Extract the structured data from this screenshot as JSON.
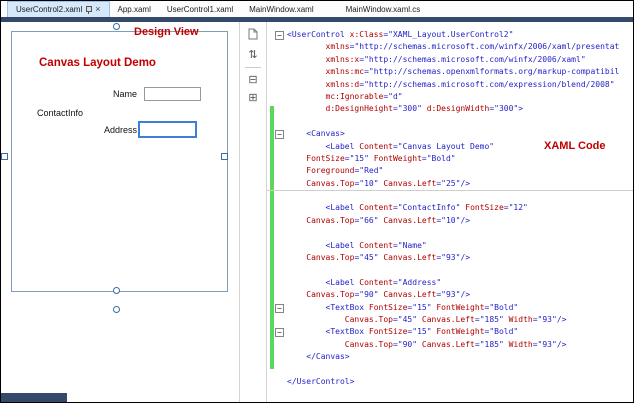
{
  "tabs": [
    {
      "label": "UserControl2.xaml",
      "active": true
    },
    {
      "label": "App.xaml",
      "active": false
    },
    {
      "label": "UserControl1.xaml",
      "active": false
    },
    {
      "label": "MainWindow.xaml",
      "active": false
    },
    {
      "label": "MainWindow.xaml.cs",
      "active": false
    }
  ],
  "icons": {
    "pin": "css-pin-shape",
    "close_glyph": "×",
    "document": "svg-page-shape",
    "swap_glyph": "⇅",
    "hsplit_glyph": "⊟",
    "vsplit_glyph": "⊞",
    "fold_glyph": "−"
  },
  "design": {
    "annotation": "Design View",
    "canvas_title": "Canvas Layout Demo",
    "name_label": "Name",
    "contactinfo_label": "ContactInfo",
    "address_label": "Address",
    "name_value": "",
    "address_value": ""
  },
  "annotations": {
    "xaml_code": "XAML Code"
  },
  "colors": {
    "accent_navy": "#35496b",
    "annotation_red": "#c00000",
    "code_tag_blue": "#1f1fc8",
    "code_attr_red": "#b00000",
    "code_value_blue": "#1f1fc8",
    "selection_blue": "#3d7fd6",
    "change_bar_green": "#5cd65c",
    "active_tab_bg": "#d6e9fb"
  },
  "code": {
    "lines": [
      {
        "fold": true,
        "seg": [
          [
            "t",
            "<UserControl "
          ],
          [
            "a",
            "x:Class"
          ],
          [
            "t",
            "="
          ],
          [
            "v",
            "\"XAML_Layout.UserControl2\""
          ]
        ]
      },
      {
        "seg": [
          [
            "t",
            "        "
          ],
          [
            "a",
            "xmlns"
          ],
          [
            "t",
            "="
          ],
          [
            "v",
            "\"http://schemas.microsoft.com/winfx/2006/xaml/presentat"
          ]
        ]
      },
      {
        "seg": [
          [
            "t",
            "        "
          ],
          [
            "a",
            "xmlns:x"
          ],
          [
            "t",
            "="
          ],
          [
            "v",
            "\"http://schemas.microsoft.com/winfx/2006/xaml\""
          ]
        ]
      },
      {
        "seg": [
          [
            "t",
            "        "
          ],
          [
            "a",
            "xmlns:mc"
          ],
          [
            "t",
            "="
          ],
          [
            "v",
            "\"http://schemas.openxmlformats.org/markup-compatibil"
          ]
        ]
      },
      {
        "seg": [
          [
            "t",
            "        "
          ],
          [
            "a",
            "xmlns:d"
          ],
          [
            "t",
            "="
          ],
          [
            "v",
            "\"http://schemas.microsoft.com/expression/blend/2008\""
          ]
        ]
      },
      {
        "seg": [
          [
            "t",
            "        "
          ],
          [
            "a",
            "mc:Ignorable"
          ],
          [
            "t",
            "="
          ],
          [
            "v",
            "\"d\""
          ]
        ]
      },
      {
        "seg": [
          [
            "t",
            "        "
          ],
          [
            "a",
            "d:DesignHeight"
          ],
          [
            "t",
            "="
          ],
          [
            "v",
            "\"300\""
          ],
          [
            "t",
            " "
          ],
          [
            "a",
            "d:DesignWidth"
          ],
          [
            "t",
            "="
          ],
          [
            "v",
            "\"300\""
          ],
          [
            "t",
            ">"
          ]
        ]
      },
      {
        "seg": []
      },
      {
        "fold": true,
        "seg": [
          [
            "t",
            "    <Canvas>"
          ]
        ]
      },
      {
        "seg": [
          [
            "t",
            "        <Label "
          ],
          [
            "a",
            "Content"
          ],
          [
            "t",
            "="
          ],
          [
            "v",
            "\"Canvas Layout Demo\""
          ]
        ]
      },
      {
        "seg": [
          [
            "t",
            "    "
          ],
          [
            "a",
            "FontSize"
          ],
          [
            "t",
            "="
          ],
          [
            "v",
            "\"15\""
          ],
          [
            "t",
            " "
          ],
          [
            "a",
            "FontWeight"
          ],
          [
            "t",
            "="
          ],
          [
            "v",
            "\"Bold\""
          ]
        ]
      },
      {
        "seg": [
          [
            "t",
            "    "
          ],
          [
            "a",
            "Foreground"
          ],
          [
            "t",
            "="
          ],
          [
            "v",
            "\"Red\""
          ]
        ]
      },
      {
        "seg": [
          [
            "t",
            "    "
          ],
          [
            "a",
            "Canvas.Top"
          ],
          [
            "t",
            "="
          ],
          [
            "v",
            "\"10\""
          ],
          [
            "t",
            " "
          ],
          [
            "a",
            "Canvas.Left"
          ],
          [
            "t",
            "="
          ],
          [
            "v",
            "\"25\""
          ],
          [
            "t",
            "/>"
          ]
        ]
      },
      {
        "rule": true,
        "seg": []
      },
      {
        "seg": [
          [
            "t",
            "        <Label "
          ],
          [
            "a",
            "Content"
          ],
          [
            "t",
            "="
          ],
          [
            "v",
            "\"ContactInfo\""
          ],
          [
            "t",
            " "
          ],
          [
            "a",
            "FontSize"
          ],
          [
            "t",
            "="
          ],
          [
            "v",
            "\"12\""
          ]
        ]
      },
      {
        "seg": [
          [
            "t",
            "    "
          ],
          [
            "a",
            "Canvas.Top"
          ],
          [
            "t",
            "="
          ],
          [
            "v",
            "\"66\""
          ],
          [
            "t",
            " "
          ],
          [
            "a",
            "Canvas.Left"
          ],
          [
            "t",
            "="
          ],
          [
            "v",
            "\"10\""
          ],
          [
            "t",
            "/>"
          ]
        ]
      },
      {
        "seg": []
      },
      {
        "seg": [
          [
            "t",
            "        <Label "
          ],
          [
            "a",
            "Content"
          ],
          [
            "t",
            "="
          ],
          [
            "v",
            "\"Name\""
          ]
        ]
      },
      {
        "seg": [
          [
            "t",
            "    "
          ],
          [
            "a",
            "Canvas.Top"
          ],
          [
            "t",
            "="
          ],
          [
            "v",
            "\"45\""
          ],
          [
            "t",
            " "
          ],
          [
            "a",
            "Canvas.Left"
          ],
          [
            "t",
            "="
          ],
          [
            "v",
            "\"93\""
          ],
          [
            "t",
            "/>"
          ]
        ]
      },
      {
        "seg": []
      },
      {
        "seg": [
          [
            "t",
            "        <Label "
          ],
          [
            "a",
            "Content"
          ],
          [
            "t",
            "="
          ],
          [
            "v",
            "\"Address\""
          ]
        ]
      },
      {
        "seg": [
          [
            "t",
            "    "
          ],
          [
            "a",
            "Canvas.Top"
          ],
          [
            "t",
            "="
          ],
          [
            "v",
            "\"90\""
          ],
          [
            "t",
            " "
          ],
          [
            "a",
            "Canvas.Left"
          ],
          [
            "t",
            "="
          ],
          [
            "v",
            "\"93\""
          ],
          [
            "t",
            "/>"
          ]
        ]
      },
      {
        "fold": true,
        "seg": [
          [
            "t",
            "        <TextBox "
          ],
          [
            "a",
            "FontSize"
          ],
          [
            "t",
            "="
          ],
          [
            "v",
            "\"15\""
          ],
          [
            "t",
            " "
          ],
          [
            "a",
            "FontWeight"
          ],
          [
            "t",
            "="
          ],
          [
            "v",
            "\"Bold\""
          ]
        ]
      },
      {
        "seg": [
          [
            "t",
            "            "
          ],
          [
            "a",
            "Canvas.Top"
          ],
          [
            "t",
            "="
          ],
          [
            "v",
            "\"45\""
          ],
          [
            "t",
            " "
          ],
          [
            "a",
            "Canvas.Left"
          ],
          [
            "t",
            "="
          ],
          [
            "v",
            "\"185\""
          ],
          [
            "t",
            " "
          ],
          [
            "a",
            "Width"
          ],
          [
            "t",
            "="
          ],
          [
            "v",
            "\"93\""
          ],
          [
            "t",
            "/>"
          ]
        ]
      },
      {
        "fold": true,
        "seg": [
          [
            "t",
            "        <TextBox "
          ],
          [
            "a",
            "FontSize"
          ],
          [
            "t",
            "="
          ],
          [
            "v",
            "\"15\""
          ],
          [
            "t",
            " "
          ],
          [
            "a",
            "FontWeight"
          ],
          [
            "t",
            "="
          ],
          [
            "v",
            "\"Bold\""
          ]
        ]
      },
      {
        "seg": [
          [
            "t",
            "            "
          ],
          [
            "a",
            "Canvas.Top"
          ],
          [
            "t",
            "="
          ],
          [
            "v",
            "\"90\""
          ],
          [
            "t",
            " "
          ],
          [
            "a",
            "Canvas.Left"
          ],
          [
            "t",
            "="
          ],
          [
            "v",
            "\"185\""
          ],
          [
            "t",
            " "
          ],
          [
            "a",
            "Width"
          ],
          [
            "t",
            "="
          ],
          [
            "v",
            "\"93\""
          ],
          [
            "t",
            "/>"
          ]
        ]
      },
      {
        "seg": [
          [
            "t",
            "    </Canvas>"
          ]
        ]
      },
      {
        "seg": []
      },
      {
        "seg": [
          [
            "t",
            "</UserControl>"
          ]
        ]
      }
    ]
  }
}
